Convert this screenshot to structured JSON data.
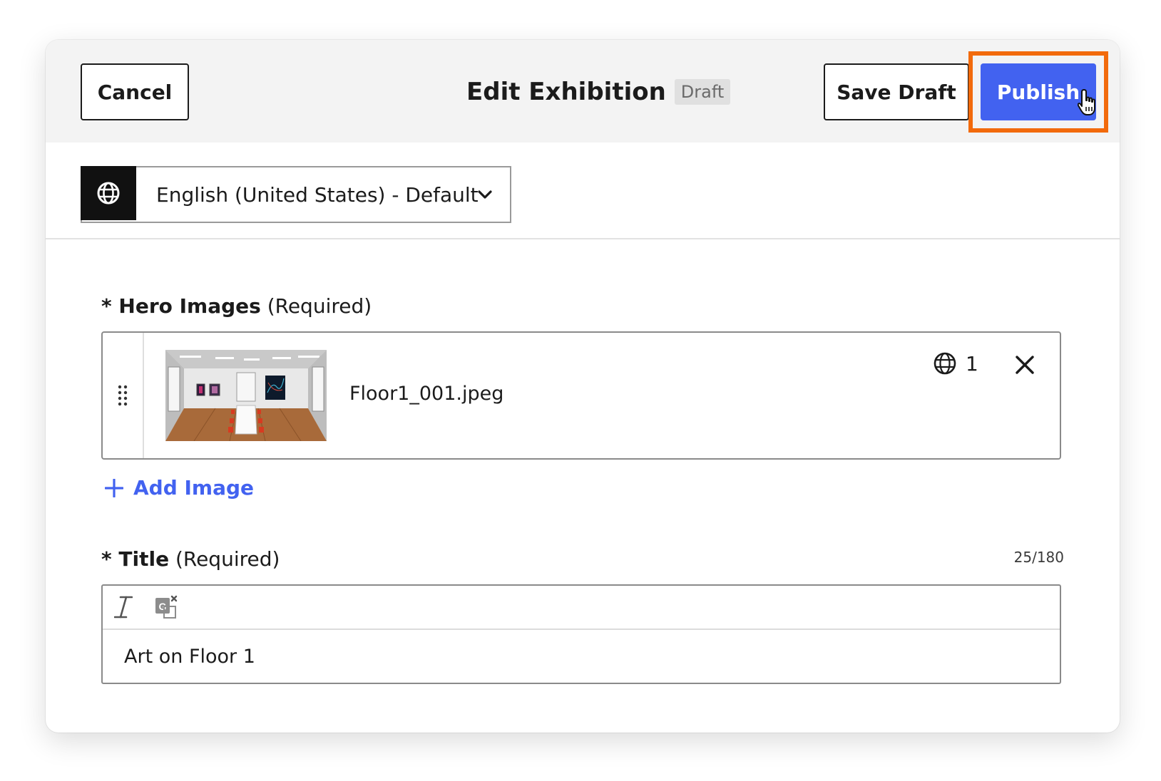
{
  "header": {
    "cancel_label": "Cancel",
    "title": "Edit Exhibition",
    "status_badge": "Draft",
    "save_draft_label": "Save Draft",
    "publish_label": "Publish"
  },
  "language": {
    "selected": "English (United States) - Default",
    "icon": "globe-icon"
  },
  "hero_images": {
    "label_bold": "* Hero Images",
    "label_suffix": " (Required)",
    "items": [
      {
        "file_name": "Floor1_001.jpeg",
        "language_count": "1"
      }
    ],
    "add_label": "Add Image"
  },
  "title_field": {
    "label_bold": "* Title",
    "label_suffix": " (Required)",
    "char_count": "25/180",
    "value": "Art on Floor 1"
  },
  "colors": {
    "accent": "#4262f0",
    "highlight": "#f26a0c",
    "header_bg": "#f3f3f3"
  }
}
